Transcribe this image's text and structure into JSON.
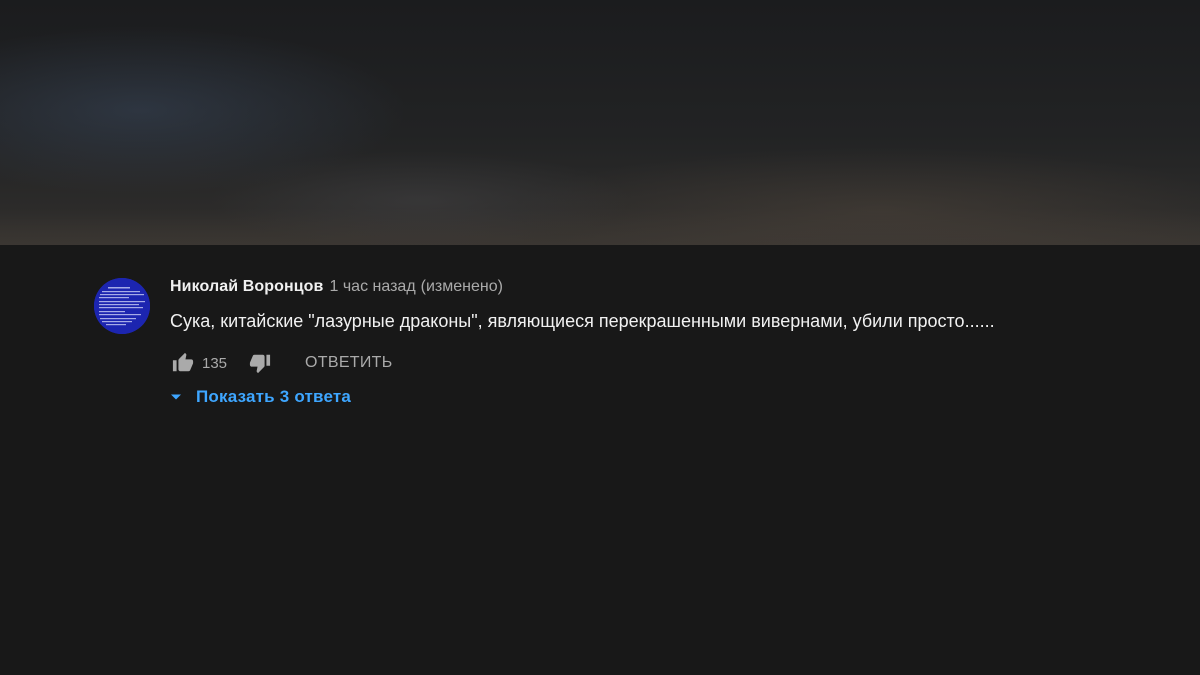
{
  "comment": {
    "author": "Николай Воронцов",
    "time": "1 час назад",
    "edited": "(изменено)",
    "text": "Сука, китайские \"лазурные драконы\", являющиеся перекрашенными вивернами, убили просто......",
    "like_count": "135",
    "reply_label": "ОТВЕТИТЬ",
    "show_replies_label": "Показать 3 ответа",
    "avatar_icon": "bsod-avatar",
    "like_icon": "thumb-up-icon",
    "dislike_icon": "thumb-down-icon",
    "expand_icon": "caret-down-icon"
  },
  "colors": {
    "background": "#181818",
    "text_primary": "#f1f1f1",
    "text_secondary": "#aaaaaa",
    "link_blue": "#3ea6ff",
    "avatar_blue": "#1a23a8"
  }
}
